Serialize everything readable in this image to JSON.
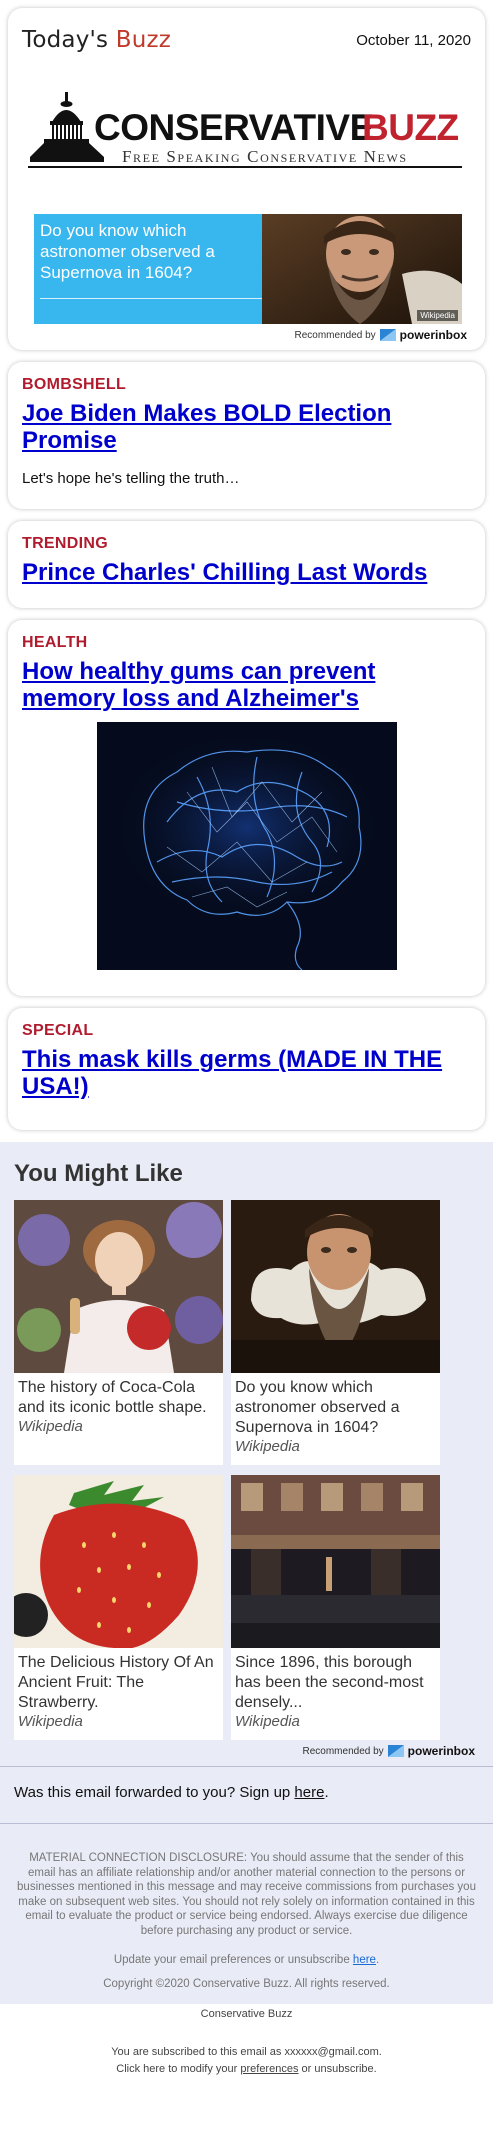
{
  "header": {
    "today_prefix": "Today's",
    "today_buzz": "Buzz",
    "date": "October 11, 2020"
  },
  "logo": {
    "name_left": "CONSERVATIVE",
    "name_right": "BUZZ",
    "tagline": "Free Speaking Conservative News"
  },
  "ad": {
    "question": "Do you know which astronomer observed a Supernova in 1604?",
    "source_badge": "Wikipedia",
    "recommended_by": "Recommended by",
    "brand": "powerinbox"
  },
  "stories": [
    {
      "tag": "BOMBSHELL",
      "headline": "Joe Biden Makes BOLD Election Promise",
      "teaser": "Let's hope he's telling the truth…"
    },
    {
      "tag": "TRENDING",
      "headline": "Prince Charles' Chilling Last Words"
    },
    {
      "tag": "HEALTH",
      "headline": "How healthy gums can prevent memory loss and Alzheimer's"
    },
    {
      "tag": "SPECIAL",
      "headline": "This mask kills germs (MADE IN THE USA!)"
    }
  ],
  "you_might_like": {
    "title": "You Might Like",
    "items": [
      {
        "text": "The history of Coca-Cola and its iconic bottle shape.",
        "source": "Wikipedia"
      },
      {
        "text": "Do you know which astronomer observed a Supernova in 1604?",
        "source": "Wikipedia"
      },
      {
        "text": "The Delicious History Of An Ancient Fruit: The Strawberry.",
        "source": "Wikipedia"
      },
      {
        "text": "Since 1896, this borough has been the second-most densely...",
        "source": "Wikipedia"
      }
    ],
    "recommended_by": "Recommended by",
    "brand": "powerinbox"
  },
  "forward": {
    "text": "Was this email forwarded to you? Sign up",
    "link": "here",
    "end": "."
  },
  "disclosure": "MATERIAL CONNECTION DISCLOSURE: You should assume that the sender of this email has an affiliate relationship and/or another material connection to the persons or businesses mentioned in this message and may receive commissions from purchases you make on subsequent web sites. You should not rely solely on information contained in this email to evaluate the product or service being endorsed. Always exercise due diligence before purchasing any product or service.",
  "update": {
    "text": "Update your email preferences or unsubscribe",
    "link": "here",
    "end": "."
  },
  "copyright": "Copyright ©2020 Conservative Buzz. All rights reserved.",
  "footer": {
    "brand": "Conservative Buzz",
    "subscribed": "You are subscribed to this email as xxxxxx@gmail.com.",
    "modify_prefix": "Click here to modify your",
    "modify_link": "preferences",
    "modify_suffix": "or unsubscribe."
  },
  "colors": {
    "accent_red": "#b01c2e",
    "link_blue": "#0000cc",
    "ad_blue": "#38b6ee",
    "panel_bg": "#e9ebf6"
  },
  "icons": [
    "capitol-dome-icon",
    "powerinbox-icon"
  ]
}
